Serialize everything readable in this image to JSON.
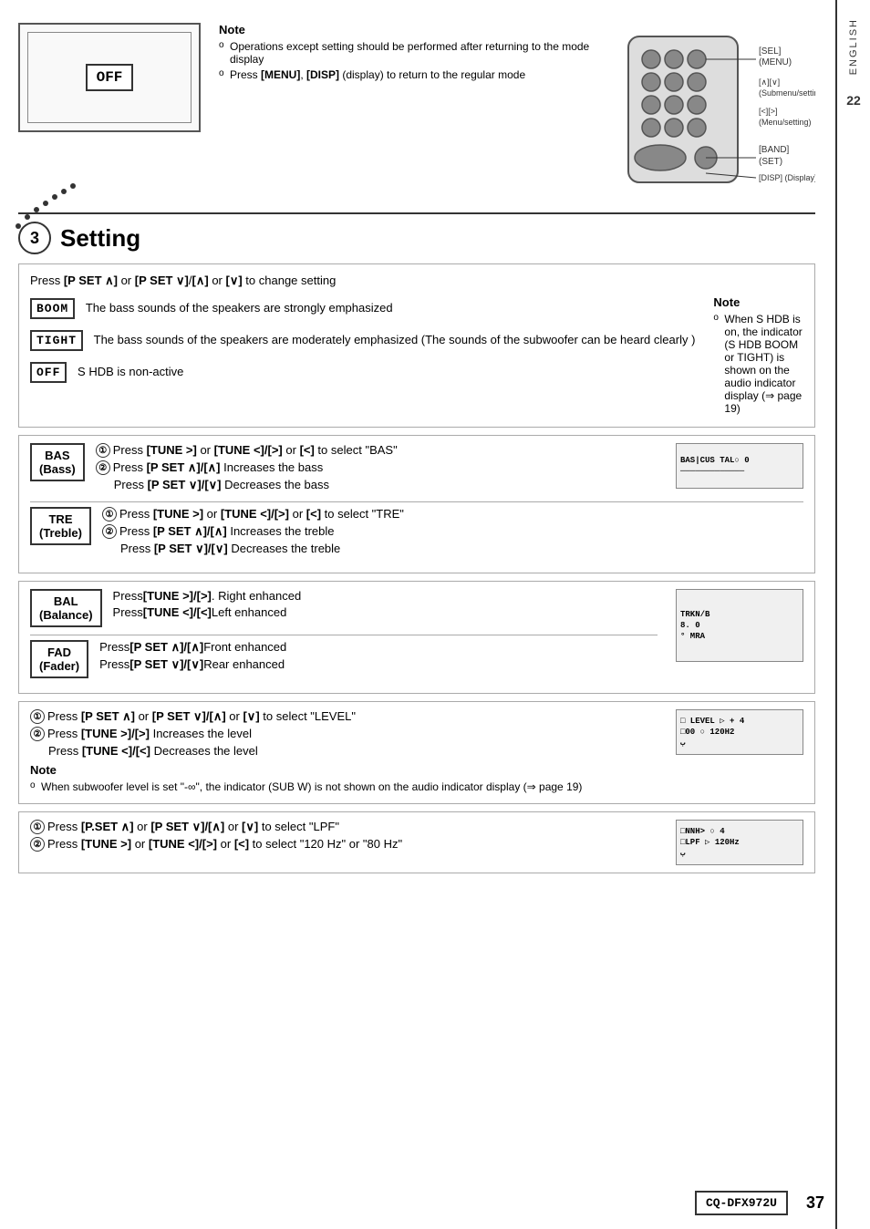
{
  "page": {
    "number": "37",
    "model": "CQ-DFX972U",
    "tab_text": "ENGLISH",
    "tab_number": "22"
  },
  "note": {
    "title": "Note",
    "bullets": [
      "Operations except setting should be performed after returning to the mode display",
      "Press [MENU], [DISP] (display) to return to the regular mode"
    ]
  },
  "section3": {
    "number": "3",
    "title": "Setting"
  },
  "remote_labels": {
    "sel_menu": "[SEL] (MENU)",
    "band_set": "[BAND] (SET)",
    "submenu": "[∧][∨] (Submenu/setting)",
    "menu": "[<][>] (Menu/setting)",
    "disp": "[DISP] (Display)"
  },
  "shdb_section": {
    "intro": "Press [P SET ∧] or [P SET ∨]/[∧] or [∨] to change setting",
    "boom_label": "BOOM",
    "tight_label": "TIGHT",
    "off_label": "OFF",
    "boom_desc": "The bass sounds of the speakers are strongly emphasized",
    "tight_desc": "The bass sounds of the speakers are moderately emphasized (The sounds of the subwoofer can be heard clearly )",
    "off_desc": "S HDB is non-active",
    "note_title": "Note",
    "note_bullet": "When S HDB is on, the indicator (S HDB BOOM or TIGHT) is shown on the audio indicator display (⇒ page 19)"
  },
  "bass_section": {
    "label_line1": "BAS",
    "label_line2": "(Bass)",
    "step1": "Press [TUNE >] or [TUNE <]/[>] or [<] to select \"BAS\"",
    "step2a": "Press [P SET ∧]/[∧]  Increases the bass",
    "step2b": "Press [P SET ∨]/[∨]  Decreases the bass"
  },
  "treble_section": {
    "label_line1": "TRE",
    "label_line2": "(Treble)",
    "step1": "Press [TUNE >] or [TUNE <]/[>] or [<] to select \"TRE\"",
    "step2a": "Press [P SET ∧]/[∧]  Increases the treble",
    "step2b": "Press [P SET ∨]/[∨]  Decreases the treble"
  },
  "balance_section": {
    "label_line1": "BAL",
    "label_line2": "(Balance)",
    "step1": "Press [TUNE >]/[>].  Right enhanced",
    "step2": "Press [TUNE <]/[<]  Left enhanced"
  },
  "fader_section": {
    "label_line1": "FAD",
    "label_line2": "(Fader)",
    "step1": "Press [P SET ∧]/[∧]  Front enhanced",
    "step2": "Press [P SET ∨]/[∨]  Rear enhanced"
  },
  "subwoofer_section": {
    "step1": "Press [P SET ∧] or [P SET ∨]/[∧] or [∨] to select \"LEVEL\"",
    "step2a": "Press [TUNE >]/[>]  Increases the level",
    "step2b": "Press [TUNE <]/[<]  Decreases the level",
    "note_title": "Note",
    "note_bullet": "When subwoofer level is set \"-∞\", the indicator (SUB W) is not shown on the audio indicator display (⇒ page 19)",
    "display_line1": "□ LEVEL ▷ + 4",
    "display_line2": "□00  ○ 120H2",
    "display_line3": "ب"
  },
  "lpf_section": {
    "step1": "Press [P.SET ∧] or [P SET ∨]/[∧] or [∨] to select \"LPF\"",
    "step2": "Press [TUNE >] or [TUNE <]/[>] or [<] to select \"120 Hz\" or \"80 Hz\"",
    "display_line1": "□NNH> ○ 4",
    "display_line2": "□LPF  ▷ 120Hz",
    "display_line3": "ب"
  },
  "display_unit": {
    "off_text": "OFF"
  }
}
